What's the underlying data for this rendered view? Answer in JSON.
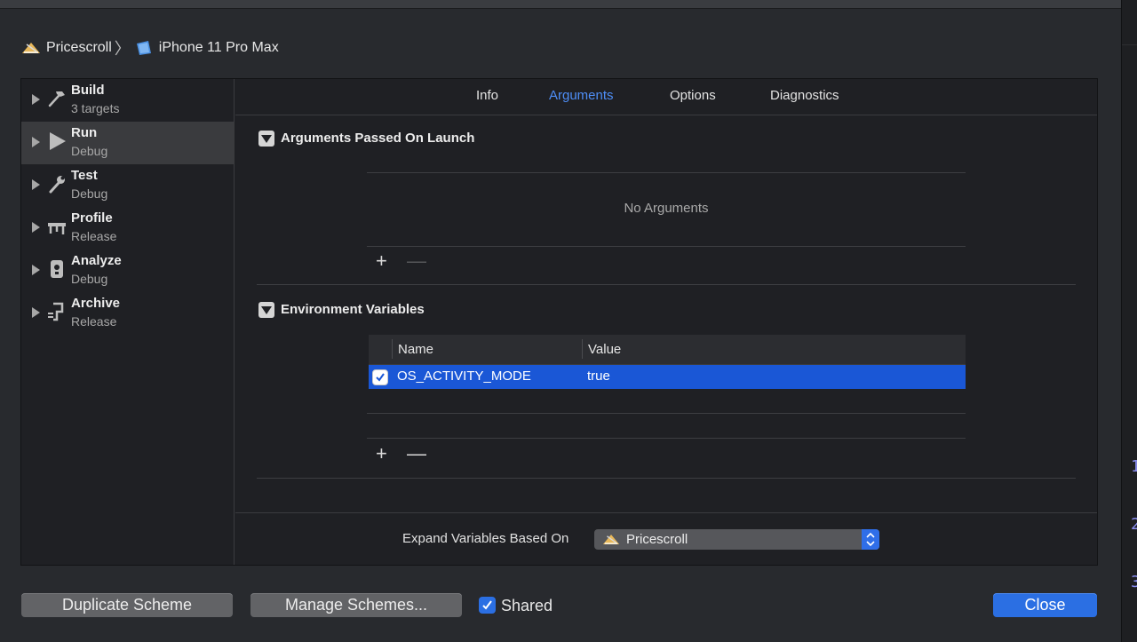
{
  "breadcrumb": {
    "app": "Pricescroll",
    "separator": "〉",
    "device": "iPhone 11 Pro Max",
    "app_icon": "app-icon",
    "device_icon": "iphone-icon"
  },
  "sidebar": {
    "items": [
      {
        "title": "Build",
        "subtitle": "3 targets",
        "icon": "hammer-icon"
      },
      {
        "title": "Run",
        "subtitle": "Debug",
        "icon": "play-icon"
      },
      {
        "title": "Test",
        "subtitle": "Debug",
        "icon": "wrench-icon"
      },
      {
        "title": "Profile",
        "subtitle": "Release",
        "icon": "instruments-icon"
      },
      {
        "title": "Analyze",
        "subtitle": "Debug",
        "icon": "analyze-icon"
      },
      {
        "title": "Archive",
        "subtitle": "Release",
        "icon": "archive-icon"
      }
    ]
  },
  "tabs": {
    "info": "Info",
    "arguments": "Arguments",
    "options": "Options",
    "diagnostics": "Diagnostics"
  },
  "arguments_section": {
    "title": "Arguments Passed On Launch",
    "empty": "No Arguments",
    "add": "+",
    "remove": "—"
  },
  "env_section": {
    "title": "Environment Variables",
    "columns": {
      "name": "Name",
      "value": "Value"
    },
    "rows": [
      {
        "enabled": true,
        "name": "OS_ACTIVITY_MODE",
        "value": "true"
      }
    ],
    "add": "+",
    "remove": "—"
  },
  "expand": {
    "label": "Expand Variables Based On",
    "value": "Pricescroll"
  },
  "footer": {
    "duplicate": "Duplicate Scheme",
    "manage": "Manage Schemes...",
    "shared_label": "Shared",
    "shared_checked": true,
    "close": "Close"
  },
  "edge_numbers": [
    "1",
    "2",
    "3"
  ],
  "colors": {
    "accent": "#2b6fe3",
    "active_tab": "#4e8ef7",
    "selection": "#1a57d6"
  }
}
